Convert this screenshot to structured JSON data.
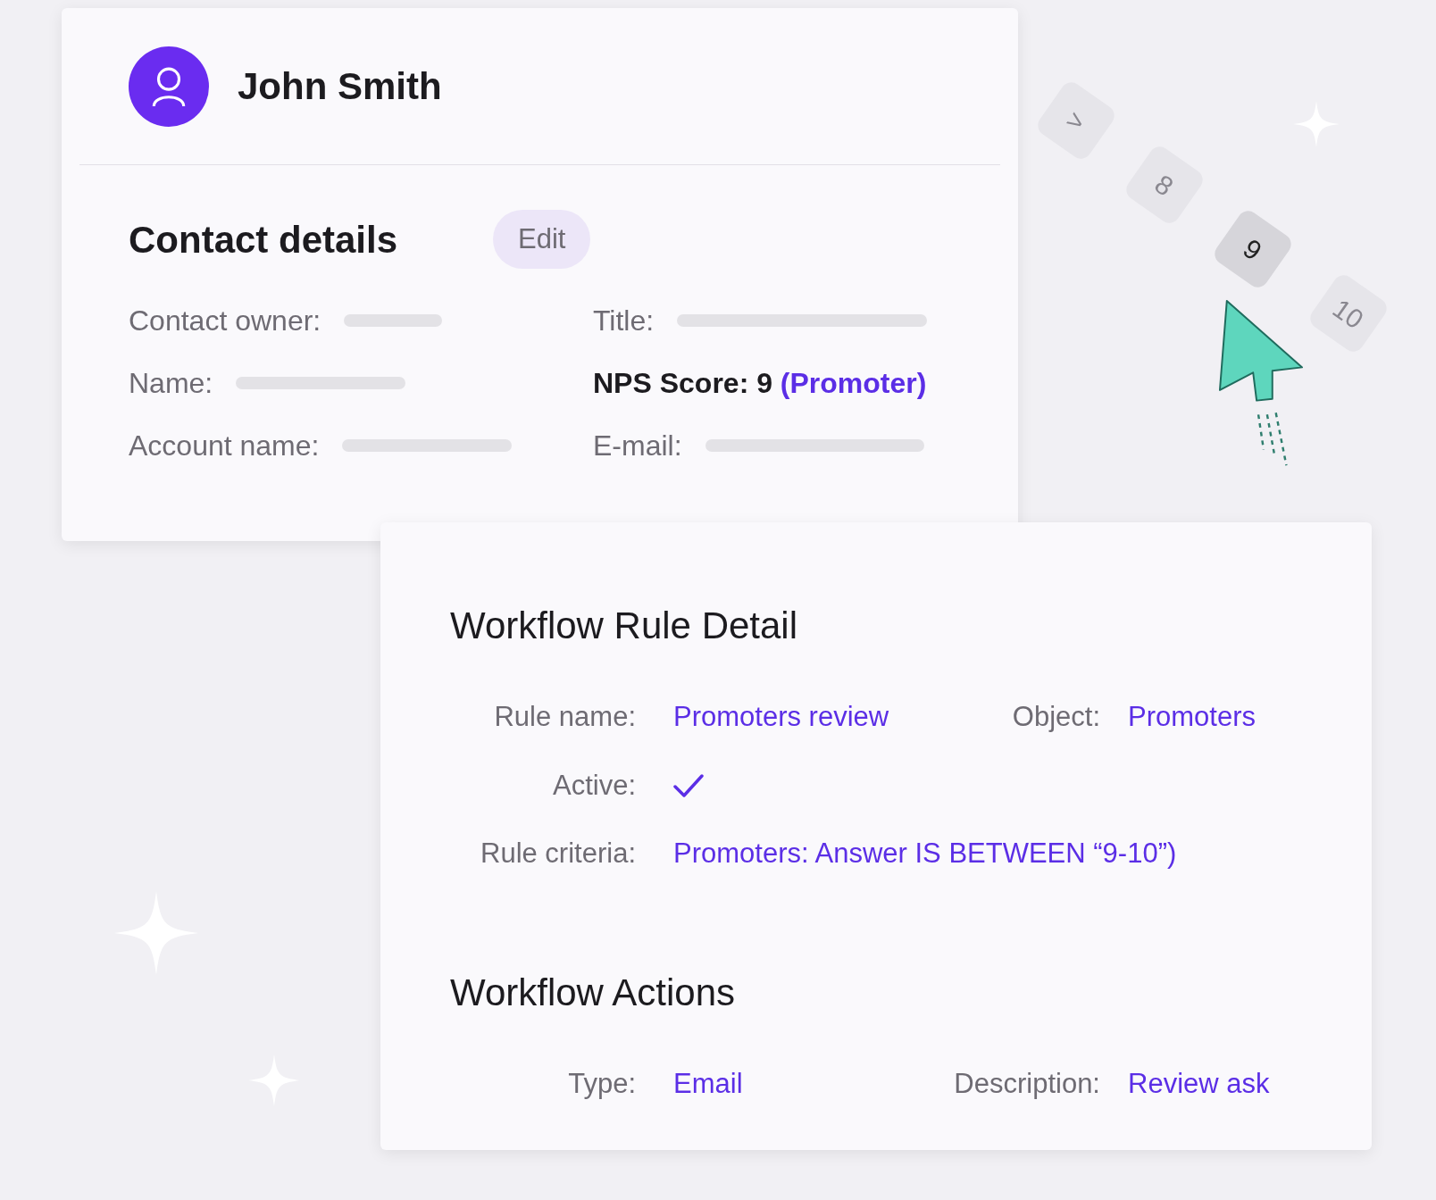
{
  "contact": {
    "name": "John Smith",
    "section_title": "Contact details",
    "edit_button": "Edit",
    "fields": [
      {
        "label": "Contact owner:",
        "kind": "blank"
      },
      {
        "label": "Title:",
        "kind": "blank"
      },
      {
        "label": "Name:",
        "kind": "blank"
      },
      {
        "label": "NPS Score: 9",
        "kind": "score",
        "value": "(Promoter)"
      },
      {
        "label": "Account name:",
        "kind": "blank"
      },
      {
        "label": "E-mail:",
        "kind": "blank"
      }
    ]
  },
  "rating_keys": [
    {
      "label": ">",
      "selected": false
    },
    {
      "label": "8",
      "selected": false
    },
    {
      "label": "9",
      "selected": true
    },
    {
      "label": "10",
      "selected": false
    }
  ],
  "rule_detail": {
    "title": "Workflow Rule Detail",
    "rows": [
      {
        "kind": "pair",
        "label": "Rule name:",
        "value": "Promoters review",
        "label_2": "Object:",
        "value_2": "Promoters"
      },
      {
        "kind": "check",
        "label": "Active:",
        "checked": true
      },
      {
        "kind": "text",
        "label": "Rule criteria:",
        "value": "Promoters: Answer IS BETWEEN “9-10”)"
      }
    ]
  },
  "actions": {
    "title": "Workflow Actions",
    "rows": [
      {
        "kind": "pair",
        "label": "Type:",
        "value": "Email",
        "label_2": "Description:",
        "value_2": "Review ask"
      }
    ]
  }
}
